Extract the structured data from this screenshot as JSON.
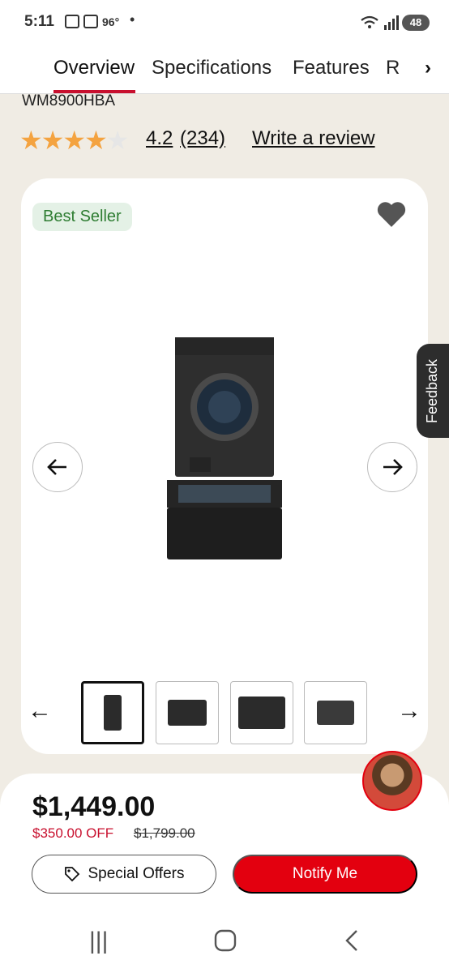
{
  "status_bar": {
    "time": "5:11",
    "temperature": "96°",
    "battery": "48"
  },
  "tabs": [
    {
      "label": "Overview",
      "active": true
    },
    {
      "label": "Specifications",
      "active": false
    },
    {
      "label": "Features",
      "active": false
    },
    {
      "label": "R",
      "active": false
    }
  ],
  "product": {
    "model": "WM8900HBA",
    "rating": "4.2",
    "review_count": "(234)",
    "write_review": "Write a review",
    "badge": "Best Seller"
  },
  "pricing": {
    "price": "$1,449.00",
    "discount": "$350.00 OFF",
    "original_price": "$1,799.00"
  },
  "buttons": {
    "special_offers": "Special Offers",
    "notify_me": "Notify Me"
  },
  "feedback_label": "Feedback",
  "colors": {
    "accent_red": "#e3000f",
    "tab_underline": "#c8102e",
    "star": "#f4a340",
    "badge_bg": "#e4f1e6",
    "badge_text": "#2e7d32"
  },
  "icons": [
    "chevron-right-icon",
    "heart-icon",
    "arrow-left-icon",
    "arrow-right-icon",
    "tag-icon",
    "recents-icon",
    "home-icon",
    "back-icon"
  ]
}
